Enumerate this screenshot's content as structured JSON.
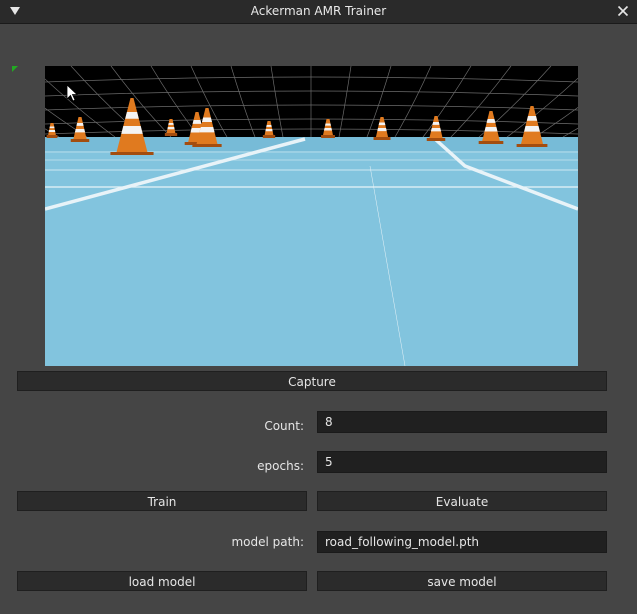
{
  "window": {
    "title": "Ackerman AMR Trainer",
    "collapse_icon": "triangle-down-icon",
    "close_icon": "close-icon"
  },
  "viewport": {
    "sky_color": "#000000",
    "grid_color": "#6b6b6b",
    "floor_color": "#82c4de",
    "floor_line_color": "#e8f3f8",
    "cone_orange": "#e07a1f",
    "cone_white": "#f4f4f4",
    "marker_color": "#22aa22"
  },
  "controls": {
    "capture_label": "Capture",
    "count_label": "Count:",
    "count_value": "8",
    "epochs_label": "epochs:",
    "epochs_value": "5",
    "train_label": "Train",
    "evaluate_label": "Evaluate",
    "model_path_label": "model path:",
    "model_path_value": "road_following_model.pth",
    "load_model_label": "load model",
    "save_model_label": "save model"
  }
}
